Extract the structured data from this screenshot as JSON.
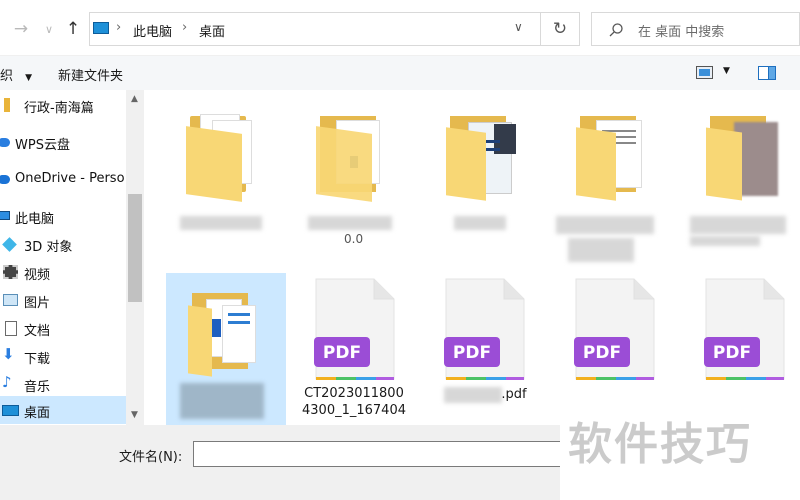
{
  "address": {
    "path": [
      "此电脑",
      "桌面"
    ]
  },
  "search": {
    "placeholder": "在 桌面 中搜索"
  },
  "toolbar": {
    "organize_label": "织",
    "new_folder_label": "新建文件夹"
  },
  "sidebar": {
    "items": [
      {
        "label": "行政-南海篇",
        "icon": "folder-icon"
      },
      {
        "label": "WPS云盘",
        "icon": "cloud-icon"
      },
      {
        "label": "OneDrive - Perso",
        "icon": "cloud-icon"
      },
      {
        "label": "此电脑",
        "icon": "computer-icon"
      },
      {
        "label": "3D 对象",
        "icon": "cube-icon"
      },
      {
        "label": "视频",
        "icon": "video-icon"
      },
      {
        "label": "图片",
        "icon": "image-icon"
      },
      {
        "label": "文档",
        "icon": "document-icon"
      },
      {
        "label": "下载",
        "icon": "download-icon"
      },
      {
        "label": "音乐",
        "icon": "music-icon"
      },
      {
        "label": "桌面",
        "icon": "desktop-icon",
        "selected": true
      }
    ]
  },
  "content": {
    "row1_partial_label": "0.0",
    "pdf_label": "PDF",
    "pdf_files": [
      {
        "name": "CT2023011800 4300_1_167404"
      },
      {
        "name": ".pdf"
      },
      {
        "name": ""
      },
      {
        "name": ""
      }
    ]
  },
  "bottom": {
    "filename_label": "文件名(N):",
    "filename_value": ""
  },
  "watermark": "软件技巧",
  "colors": {
    "accent": "#0078d4",
    "folder": "#f8d775",
    "pdf_purple": "#9b4dd6",
    "selected_bg": "#cce8ff"
  }
}
